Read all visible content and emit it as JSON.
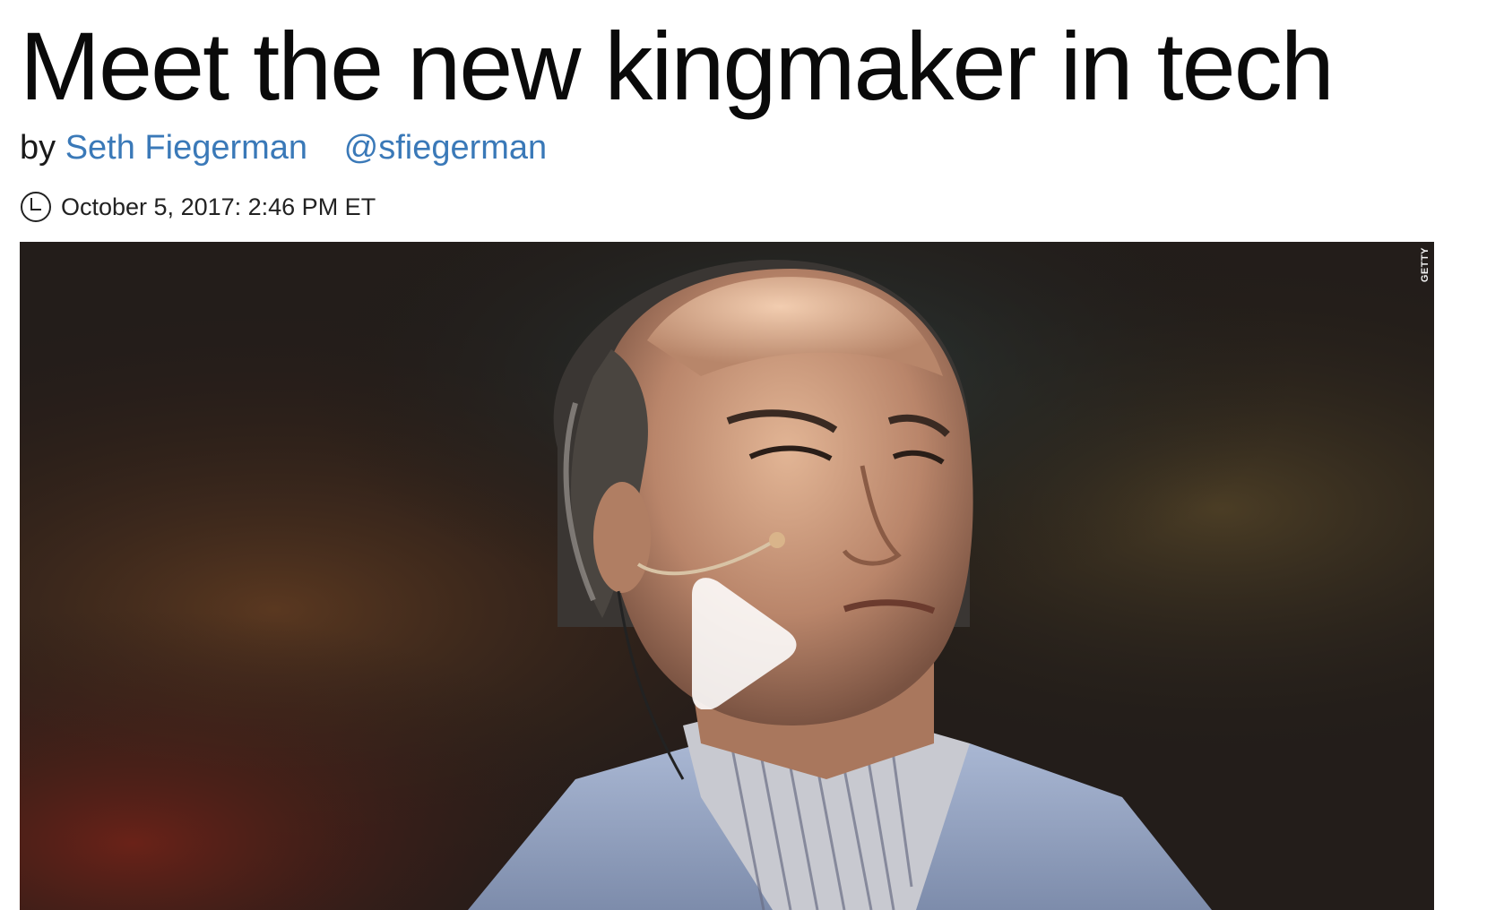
{
  "article": {
    "headline": "Meet the new kingmaker in tech",
    "byline_prefix": "by",
    "author": "Seth Fiegerman",
    "twitter_handle": "@sfiegerman",
    "timestamp": "October 5, 2017: 2:46 PM ET"
  },
  "media": {
    "photo_credit": "GETTY",
    "play_icon": "play-icon",
    "clock_icon": "clock-icon"
  },
  "colors": {
    "link": "#3a79b8",
    "headline": "#0a0a0a"
  }
}
